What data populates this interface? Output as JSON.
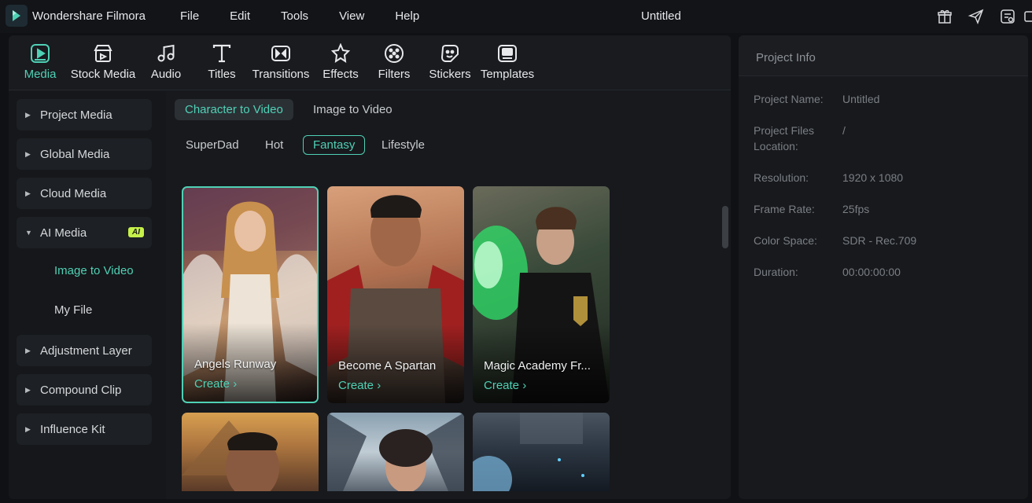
{
  "titlebar": {
    "app_name": "Wondershare Filmora",
    "menu": [
      "File",
      "Edit",
      "Tools",
      "View",
      "Help"
    ],
    "document_title": "Untitled",
    "icons": [
      "gift-icon",
      "send-icon",
      "task-list-icon"
    ]
  },
  "toolbar": {
    "tabs": [
      {
        "label": "Media",
        "icon": "media-icon",
        "active": true
      },
      {
        "label": "Stock Media",
        "icon": "stock-media-icon"
      },
      {
        "label": "Audio",
        "icon": "music-note-icon"
      },
      {
        "label": "Titles",
        "icon": "text-t-icon"
      },
      {
        "label": "Transitions",
        "icon": "transitions-icon"
      },
      {
        "label": "Effects",
        "icon": "effects-icon"
      },
      {
        "label": "Filters",
        "icon": "filters-icon"
      },
      {
        "label": "Stickers",
        "icon": "stickers-icon"
      },
      {
        "label": "Templates",
        "icon": "templates-icon"
      }
    ]
  },
  "sidebar": {
    "items": [
      {
        "label": "Project Media"
      },
      {
        "label": "Global Media"
      },
      {
        "label": "Cloud Media"
      },
      {
        "label": "AI Media",
        "expanded": true,
        "badge": "AI"
      },
      {
        "label": "Adjustment Layer"
      },
      {
        "label": "Compound Clip"
      },
      {
        "label": "Influence Kit"
      }
    ],
    "sub_items": [
      {
        "label": "Image to Video",
        "active": true
      },
      {
        "label": "My File"
      }
    ]
  },
  "content": {
    "mode_tabs": [
      {
        "label": "Character to Video",
        "active": true
      },
      {
        "label": "Image to Video"
      }
    ],
    "categories": [
      {
        "label": "SuperDad"
      },
      {
        "label": "Hot"
      },
      {
        "label": "Fantasy",
        "active": true
      },
      {
        "label": "Lifestyle"
      }
    ],
    "cards": [
      {
        "title": "Angels Runway",
        "action": "Create",
        "selected": true
      },
      {
        "title": "Become A Spartan",
        "action": "Create"
      },
      {
        "title": "Magic Academy Fr...",
        "action": "Create"
      }
    ]
  },
  "project_info": {
    "title": "Project Info",
    "fields": [
      {
        "label": "Project Name:",
        "value": "Untitled"
      },
      {
        "label": "Project Files Location:",
        "value": "/"
      },
      {
        "label": "Resolution:",
        "value": "1920 x 1080"
      },
      {
        "label": "Frame Rate:",
        "value": "25fps"
      },
      {
        "label": "Color Space:",
        "value": "SDR - Rec.709"
      },
      {
        "label": "Duration:",
        "value": "00:00:00:00"
      }
    ]
  },
  "colors": {
    "accent": "#4fd1b5",
    "background": "#0f1114",
    "panel": "#17191d",
    "ai_badge": "#c6f14a"
  }
}
